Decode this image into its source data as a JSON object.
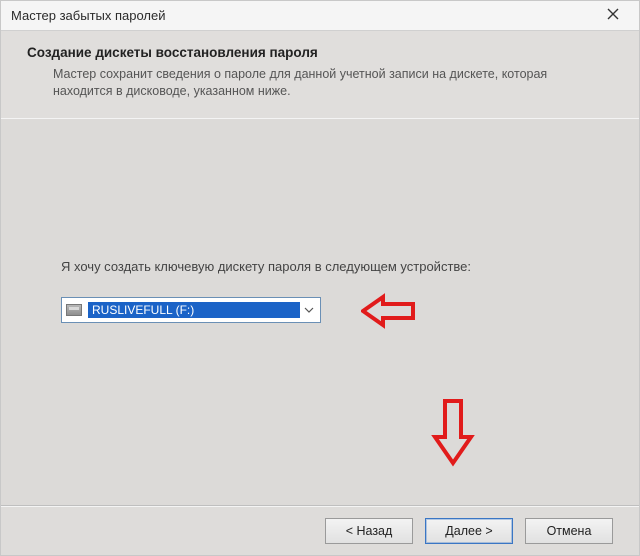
{
  "window": {
    "title": "Мастер забытых паролей"
  },
  "header": {
    "heading": "Создание дискеты восстановления пароля",
    "subtext": "Мастер сохранит сведения о пароле для данной учетной записи на дискете, которая находится в дисководе, указанном ниже."
  },
  "body": {
    "prompt": "Я хочу создать ключевую дискету пароля в следующем устройстве:",
    "drive_select": {
      "selected": "RUSLIVEFULL (F:)",
      "icon": "drive-icon"
    }
  },
  "buttons": {
    "back": "< Назад",
    "next": "Далее >",
    "cancel": "Отмена"
  },
  "annotations": {
    "arrow_color": "#e11b1b"
  }
}
